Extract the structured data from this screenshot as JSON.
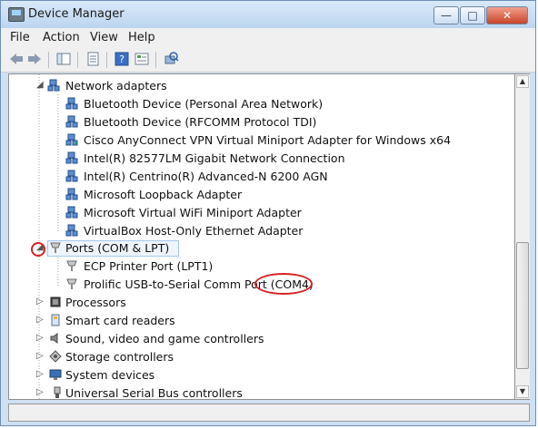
{
  "window": {
    "title": "Device Manager"
  },
  "window_buttons": {
    "minimize": "—",
    "maximize": "□",
    "close": "✕"
  },
  "menu": [
    "File",
    "Action",
    "View",
    "Help"
  ],
  "toolbar": [
    "back-icon",
    "forward-icon",
    "show-hide-tree-icon",
    "properties-icon",
    "help-icon",
    "details-icon",
    "scan-hardware-icon"
  ],
  "tree": {
    "network_adapters": {
      "label": "Network adapters",
      "items": [
        "Bluetooth Device (Personal Area Network)",
        "Bluetooth Device (RFCOMM Protocol TDI)",
        "Cisco AnyConnect VPN Virtual Miniport Adapter for Windows x64",
        "Intel(R) 82577LM Gigabit Network Connection",
        "Intel(R) Centrino(R) Advanced-N 6200 AGN",
        "Microsoft Loopback Adapter",
        "Microsoft Virtual WiFi Miniport Adapter",
        "VirtualBox Host-Only Ethernet Adapter"
      ]
    },
    "ports": {
      "label": "Ports (COM & LPT)",
      "items": [
        "ECP Printer Port (LPT1)",
        "Prolific USB-to-Serial Comm Port (COM4)"
      ]
    },
    "collapsed": [
      "Processors",
      "Smart card readers",
      "Sound, video and game controllers",
      "Storage controllers",
      "System devices",
      "Universal Serial Bus controllers"
    ]
  },
  "colors": {
    "annotation": "#d62222",
    "titlebar": "#cfe0f2"
  }
}
